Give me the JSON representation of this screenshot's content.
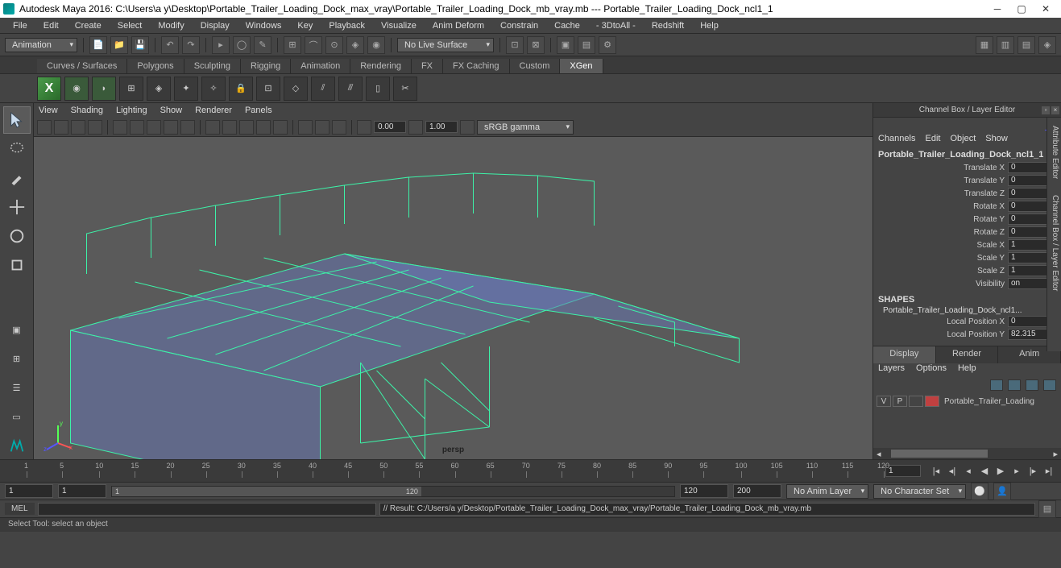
{
  "title": "Autodesk Maya 2016: C:\\Users\\a y\\Desktop\\Portable_Trailer_Loading_Dock_max_vray\\Portable_Trailer_Loading_Dock_mb_vray.mb  ---   Portable_Trailer_Loading_Dock_ncl1_1",
  "menu": [
    "File",
    "Edit",
    "Create",
    "Select",
    "Modify",
    "Display",
    "Windows",
    "Key",
    "Playback",
    "Visualize",
    "Anim Deform",
    "Constrain",
    "Cache",
    "- 3DtoAll -",
    "Redshift",
    "Help"
  ],
  "workspace_combo": "Animation",
  "live_surface": "No Live Surface",
  "shelftabs": [
    "Curves / Surfaces",
    "Polygons",
    "Sculpting",
    "Rigging",
    "Animation",
    "Rendering",
    "FX",
    "FX Caching",
    "Custom",
    "XGen"
  ],
  "shelftab_active": "XGen",
  "viewmenu": [
    "View",
    "Shading",
    "Lighting",
    "Show",
    "Renderer",
    "Panels"
  ],
  "view_toolbar": {
    "near": "0.00",
    "far": "1.00",
    "gamma": "sRGB gamma"
  },
  "viewport_label": "persp",
  "channelbox": {
    "title": "Channel Box / Layer Editor",
    "tabs": [
      "Channels",
      "Edit",
      "Object",
      "Show"
    ],
    "object": "Portable_Trailer_Loading_Dock_ncl1_1",
    "attrs": [
      {
        "label": "Translate X",
        "val": "0"
      },
      {
        "label": "Translate Y",
        "val": "0"
      },
      {
        "label": "Translate Z",
        "val": "0"
      },
      {
        "label": "Rotate X",
        "val": "0"
      },
      {
        "label": "Rotate Y",
        "val": "0"
      },
      {
        "label": "Rotate Z",
        "val": "0"
      },
      {
        "label": "Scale X",
        "val": "1"
      },
      {
        "label": "Scale Y",
        "val": "1"
      },
      {
        "label": "Scale Z",
        "val": "1"
      },
      {
        "label": "Visibility",
        "val": "on"
      }
    ],
    "shapes_header": "SHAPES",
    "shape": "Portable_Trailer_Loading_Dock_ncl1...",
    "shape_attrs": [
      {
        "label": "Local Position X",
        "val": "0"
      },
      {
        "label": "Local Position Y",
        "val": "82.315"
      }
    ],
    "layertabs": [
      "Display",
      "Render",
      "Anim"
    ],
    "layertab_active": "Display",
    "layermenu": [
      "Layers",
      "Options",
      "Help"
    ],
    "layer": {
      "v": "V",
      "p": "P",
      "name": "Portable_Trailer_Loading"
    }
  },
  "sidetabs": [
    "Attribute Editor",
    "Channel Box / Layer Editor"
  ],
  "timeline": {
    "ticks": [
      "1",
      "5",
      "10",
      "15",
      "20",
      "25",
      "30",
      "35",
      "40",
      "45",
      "50",
      "55",
      "60",
      "65",
      "70",
      "75",
      "80",
      "85",
      "90",
      "95",
      "100",
      "105",
      "110",
      "115",
      "120"
    ],
    "current": "1"
  },
  "range": {
    "start_outer": "1",
    "start_inner": "1",
    "slider_start": "1",
    "slider_end": "120",
    "end_inner": "120",
    "end_outer": "200",
    "animlayer": "No Anim Layer",
    "charset": "No Character Set"
  },
  "cmd": {
    "lang": "MEL",
    "result": "// Result: C:/Users/a y/Desktop/Portable_Trailer_Loading_Dock_max_vray/Portable_Trailer_Loading_Dock_mb_vray.mb"
  },
  "helpline": "Select Tool: select an object"
}
